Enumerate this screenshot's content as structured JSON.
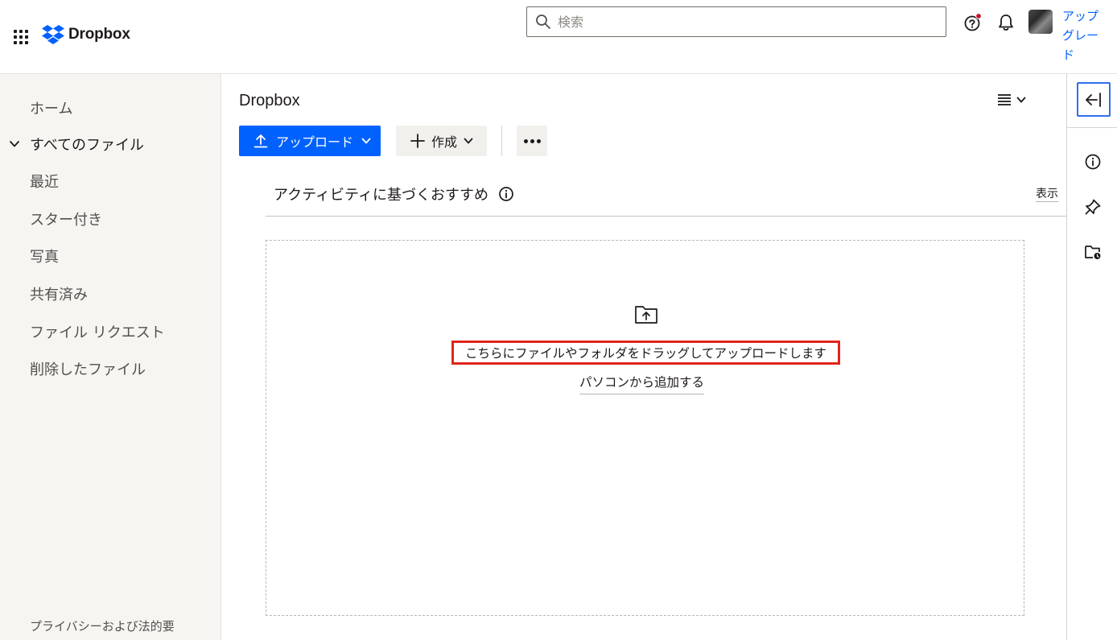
{
  "header": {
    "brand": "Dropbox",
    "search_placeholder": "検索",
    "upgrade_label": "アップグレード"
  },
  "sidebar": {
    "items": [
      {
        "label": "ホーム"
      },
      {
        "label": "すべてのファイル",
        "expanded": true,
        "active": true
      },
      {
        "label": "最近"
      },
      {
        "label": "スター付き"
      },
      {
        "label": "写真"
      },
      {
        "label": "共有済み"
      },
      {
        "label": "ファイル リクエスト"
      },
      {
        "label": "削除したファイル"
      }
    ],
    "footer_link": "プライバシーおよび法的要"
  },
  "main": {
    "title": "Dropbox",
    "toolbar": {
      "upload_label": "アップロード",
      "create_label": "作成"
    },
    "suggestions": {
      "title": "アクティビティに基づくおすすめ",
      "show_label": "表示"
    },
    "dropzone": {
      "instruction": "こちらにファイルやフォルダをドラッグしてアップロードします",
      "add_from_computer": "パソコンから追加する"
    }
  },
  "colors": {
    "accent": "#0061fe",
    "highlight_border": "#e1251b",
    "sidebar_bg": "#f7f5f2",
    "notification_dot": "#c8102e",
    "focus_ring": "#2f6fed"
  }
}
